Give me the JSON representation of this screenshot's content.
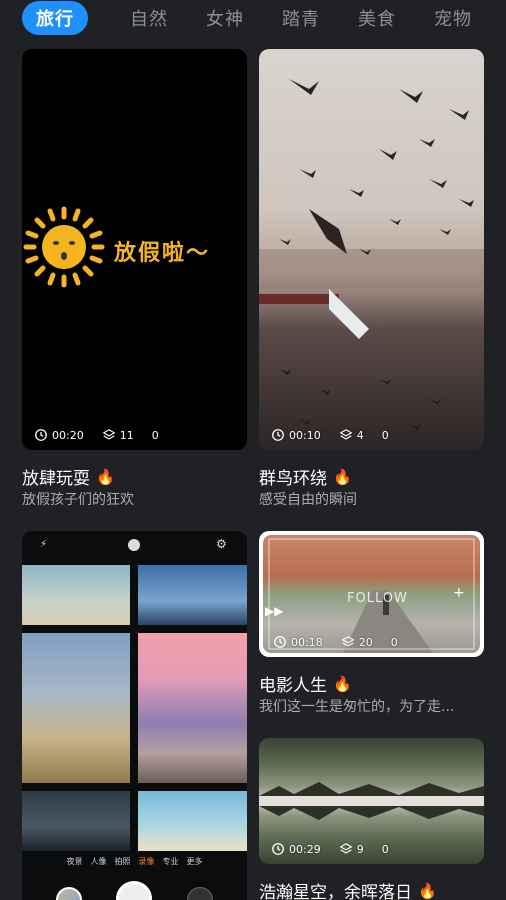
{
  "tabs": [
    "旅行",
    "自然",
    "女神",
    "踏青",
    "美食",
    "宠物"
  ],
  "cards": [
    {
      "overlay_text": "放假啦～",
      "duration": "00:20",
      "layers": "11",
      "count": "0",
      "title": "放肆玩耍",
      "subtitle": "放假孩子们的狂欢"
    },
    {
      "duration": "00:10",
      "layers": "4",
      "count": "0",
      "title": "群鸟环绕",
      "subtitle": "感受自由的瞬间"
    },
    {
      "camera_modes": [
        "夜景",
        "人像",
        "拍照",
        "录像",
        "专业",
        "更多"
      ]
    },
    {
      "overlay_text": "FOLLOW",
      "duration": "00:18",
      "layers": "20",
      "count": "0",
      "title": "电影人生",
      "subtitle": "我们这一生是匆忙的，为了走..."
    },
    {
      "duration": "00:29",
      "layers": "9",
      "count": "0",
      "title": "浩瀚星空，余晖落日"
    }
  ],
  "colors": {
    "background": "#1f2125",
    "active_tab": "#1e90ff",
    "sun": "#f5b520",
    "subtitle": "#a9acb2"
  },
  "icons": {
    "clock": "clock-icon",
    "layers": "layers-icon",
    "flame": "flame-icon"
  }
}
